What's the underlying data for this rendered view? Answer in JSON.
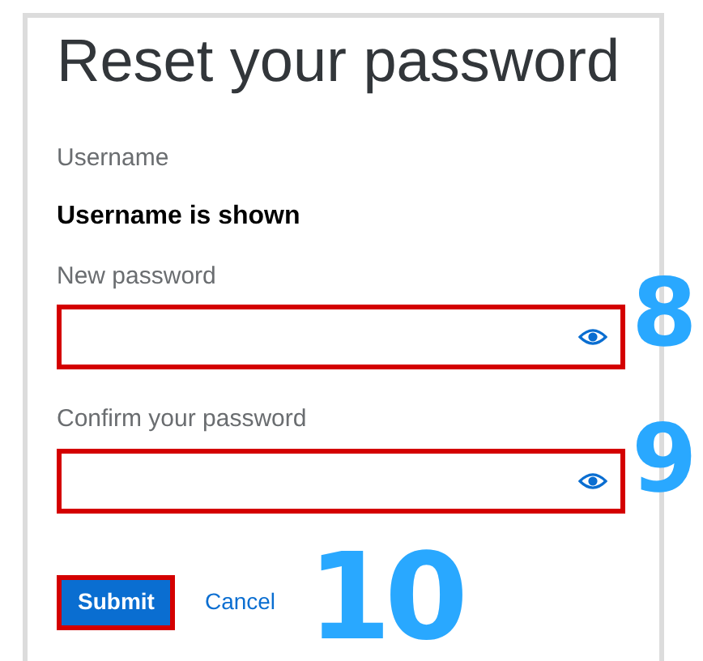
{
  "title": "Reset your password",
  "username": {
    "label": "Username",
    "value": "Username is shown"
  },
  "password_fields": [
    {
      "label": "New password",
      "highlighted": true,
      "annotation": "8"
    },
    {
      "label": "Confirm your password",
      "highlighted": true,
      "annotation": "9"
    }
  ],
  "buttons": [
    {
      "kind": "primary",
      "label": "Submit",
      "highlighted": true
    },
    {
      "kind": "link",
      "label": "Cancel",
      "highlighted": false
    }
  ],
  "buttons_annotation": "10"
}
